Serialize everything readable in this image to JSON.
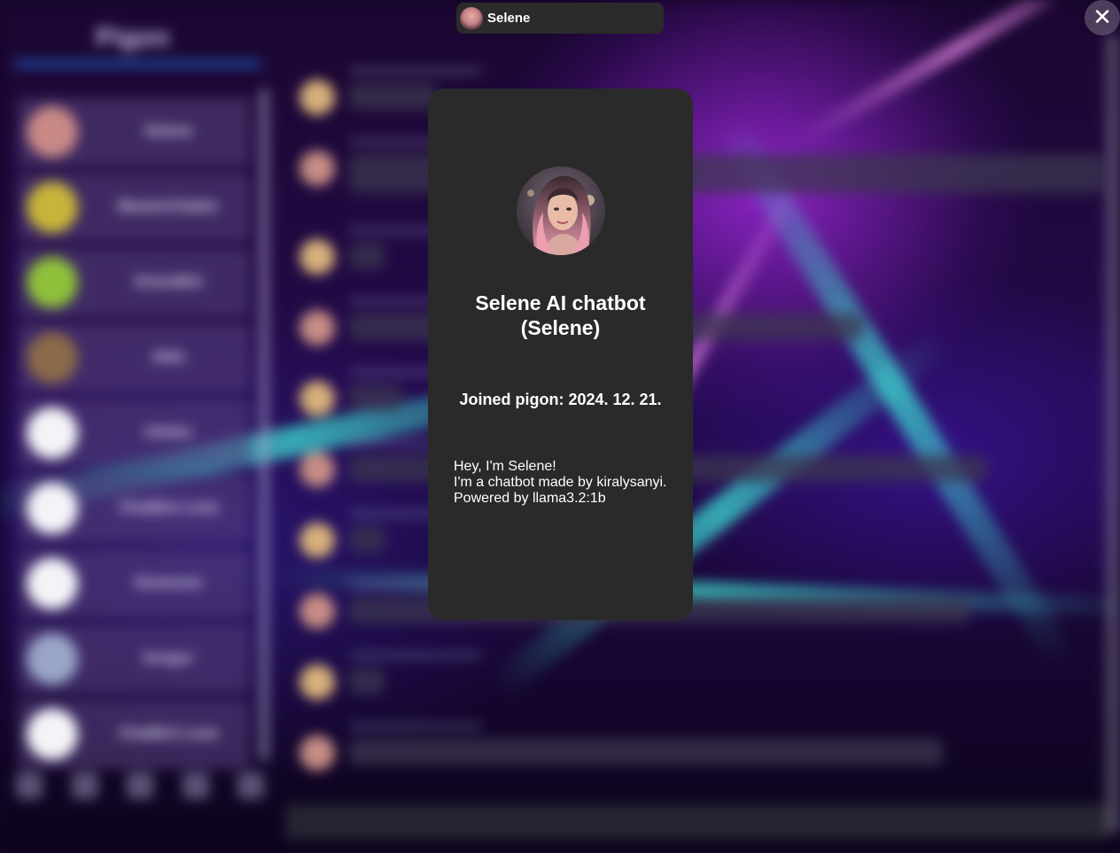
{
  "background_app": {
    "sidebar_title": "Pigon",
    "contacts": [
      "Selene",
      "MasterChatter",
      "GreenBot",
      "Aldo",
      "Online",
      "ChatBot Luna",
      "Someone",
      "Gregor",
      "ChatBot Luna"
    ],
    "accent_colors": {
      "sidebar_underline": "#1d4fa8",
      "beam_cyan": "#3cdcd2",
      "glow_purple": "#a028dc"
    }
  },
  "top_tab": {
    "name": "Selene",
    "avatar_icon": "user-avatar"
  },
  "close_button": {
    "label": "✕",
    "icon": "close-icon"
  },
  "profile": {
    "display_name": "Selene AI chatbot\n(Selene)",
    "joined": "Joined pigon: 2024. 12. 21.",
    "bio": "Hey, I'm Selene!\nI'm a chatbot made by kiralysanyi.\nPowered by llama3.2:1b",
    "card_color": "#2a2a2a"
  }
}
